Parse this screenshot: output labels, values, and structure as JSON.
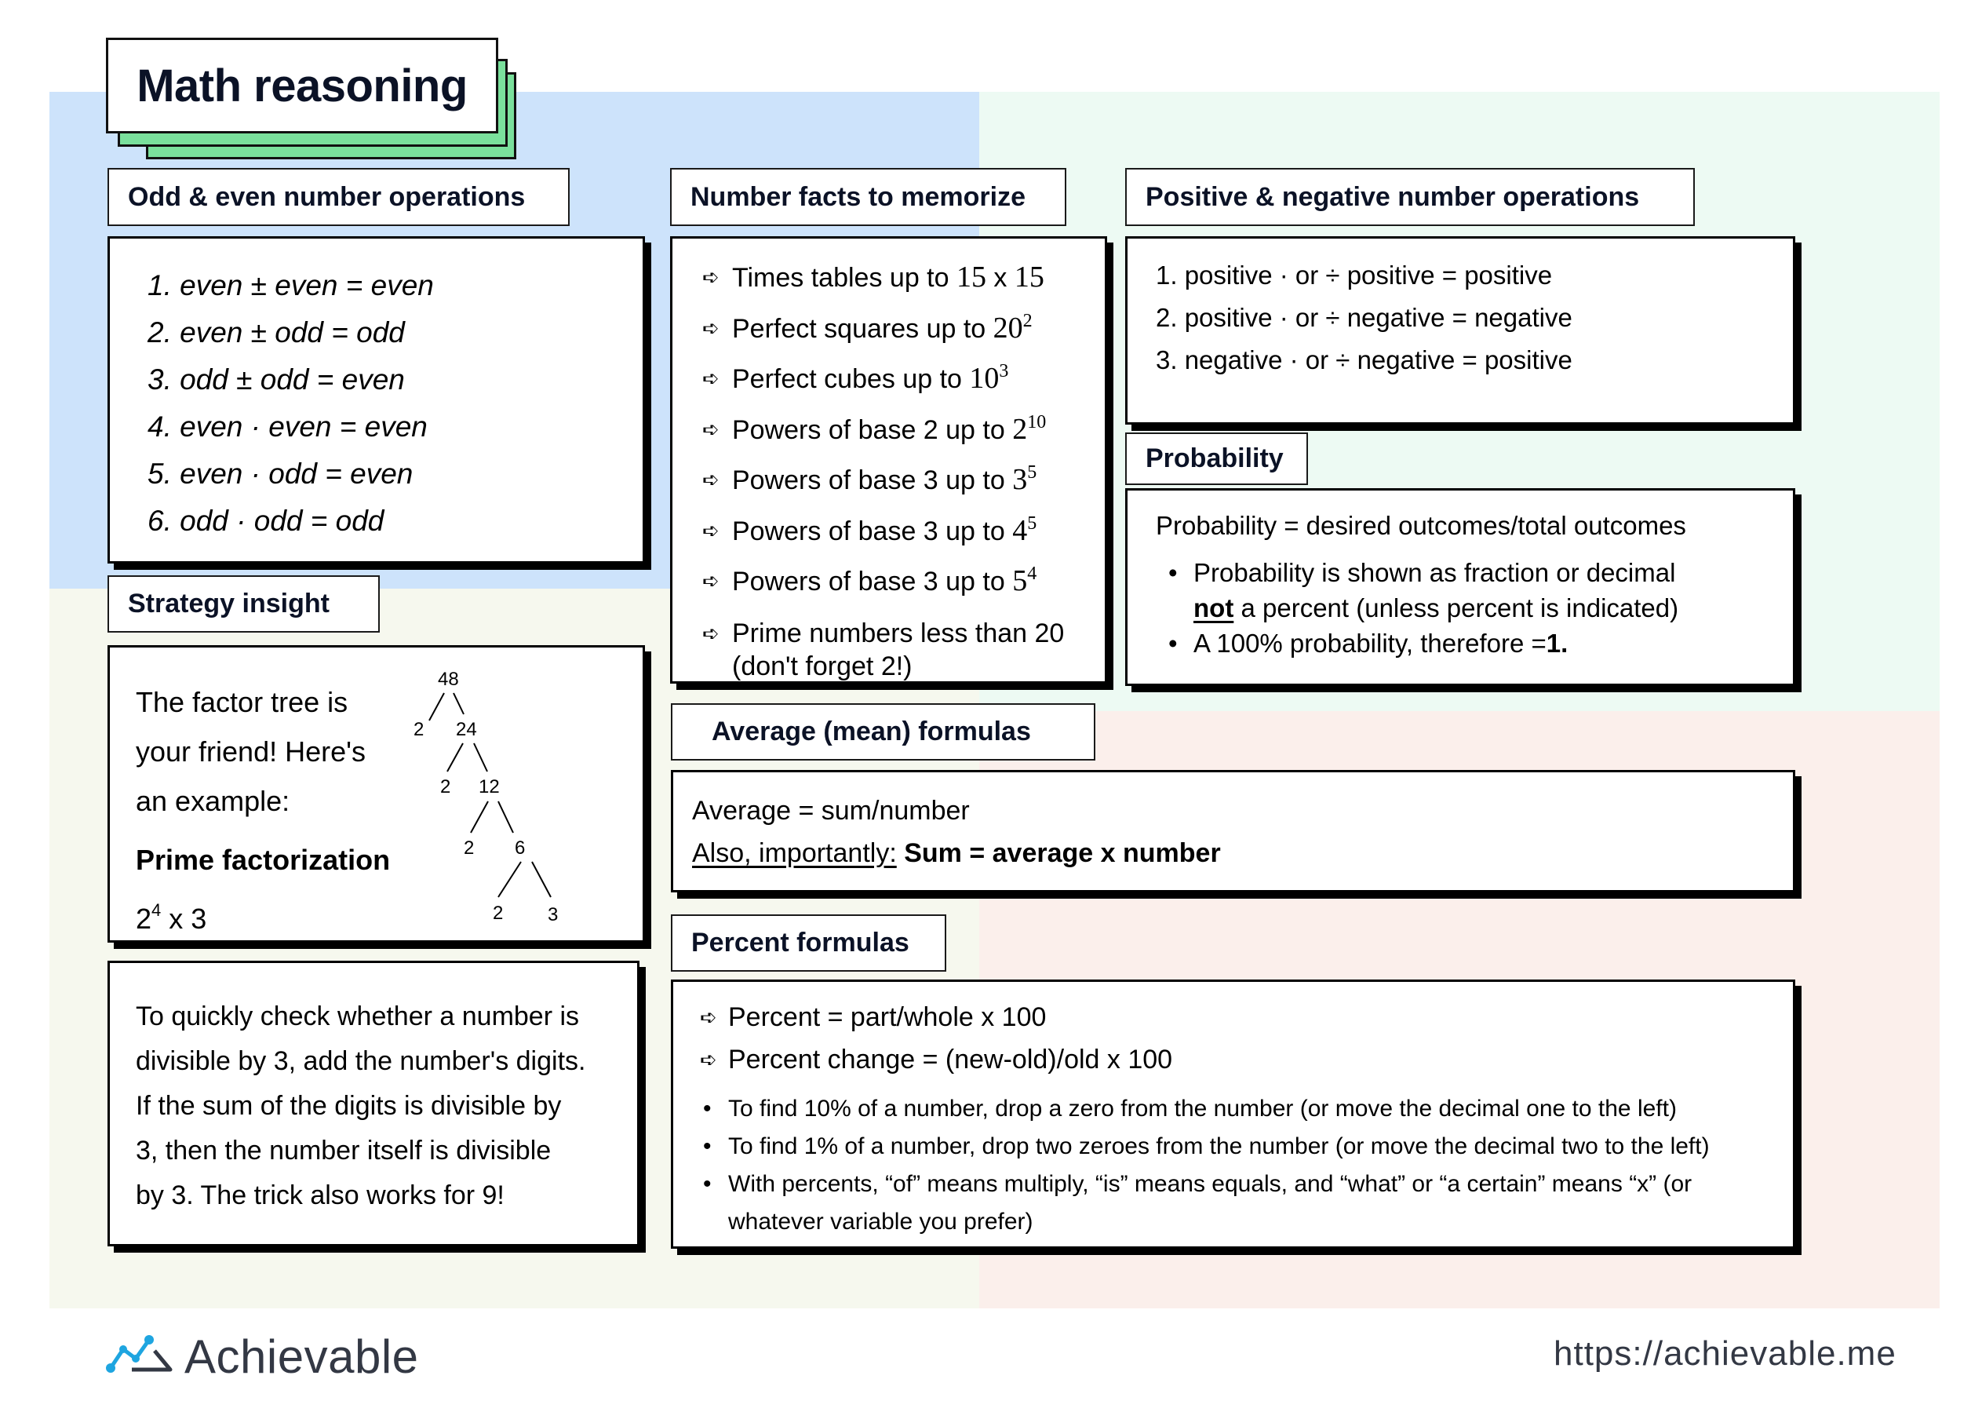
{
  "title": "Math reasoning",
  "colors": {
    "panel_blue": "#cde3fb",
    "panel_cream": "#f6f8ee",
    "panel_green": "#edfaf3",
    "panel_pink": "#fbefeb",
    "title_accent": "#7ae09c",
    "logo_blue": "#1ea5e0",
    "logo_dark": "#333844"
  },
  "odd_even": {
    "heading": "Odd & even number operations",
    "items": [
      "1. even ± even = even",
      "2. even ± odd = odd",
      "3. odd ± odd = even",
      "4. even · even = even",
      "5. even · odd = even",
      "6. odd · odd = odd"
    ]
  },
  "number_facts": {
    "heading": "Number facts to memorize",
    "bullet_icon": "➪",
    "items": [
      {
        "text": "Times tables up to ",
        "math": "15",
        "mid": " x ",
        "math2": "15",
        "sup": ""
      },
      {
        "text": "Perfect squares up to ",
        "math": "20",
        "sup": "2"
      },
      {
        "text": "Perfect cubes up to ",
        "math": "10",
        "sup": "3"
      },
      {
        "text": "Powers of base 2 up to ",
        "math": "2",
        "sup": "10"
      },
      {
        "text": "Powers of base 3 up to ",
        "math": "3",
        "sup": "5"
      },
      {
        "text": "Powers of base 3 up to ",
        "math": "4",
        "sup": "5"
      },
      {
        "text": "Powers of base 3 up to ",
        "math": "5",
        "sup": "4"
      },
      {
        "text": "Prime numbers less than 20",
        "line2": "(don't forget 2!)"
      }
    ]
  },
  "pos_neg": {
    "heading": "Positive & negative number operations",
    "items": [
      "1. positive · or ÷ positive = positive",
      "2. positive · or ÷ negative = negative",
      "3. negative · or ÷ negative = positive"
    ]
  },
  "probability": {
    "heading": "Probability",
    "formula": "Probability = desired outcomes/total outcomes",
    "bullet1_line1": "Probability is shown as fraction or decimal",
    "bullet1_not": "not",
    "bullet1_line2": " a percent (unless percent is indicated)",
    "bullet2_text": "A 100% probability, therefore =",
    "bullet2_bold": "1."
  },
  "strategy": {
    "heading": "Strategy insight",
    "intro": [
      "The factor tree is",
      "your friend! Here's",
      "an example:"
    ],
    "pf_label": "Prime factorization",
    "result_base": "2",
    "result_exp": "4",
    "result_rest": " x 3",
    "tree_nodes": [
      "48",
      "2",
      "24",
      "2",
      "12",
      "2",
      "6",
      "2",
      "3"
    ],
    "divisibility": [
      "To quickly check whether a number is",
      "divisible by 3, add the number's digits.",
      "If the sum of the digits is divisible by",
      "3, then the number itself is divisible",
      "by 3. The trick also works for 9!"
    ]
  },
  "average": {
    "heading": "Average (mean) formulas",
    "line1": "Average = sum/number",
    "line2_underlined": "Also, importantly:",
    "line2_bold": "Sum = average x number"
  },
  "percent": {
    "heading": "Percent formulas",
    "bullet_icon": "➪",
    "formulas": [
      "Percent = part/whole x 100",
      "Percent change = (new-old)/old x 100"
    ],
    "tips": [
      "To find 10% of a number, drop a zero from the number (or move the decimal one to the left)",
      "To find 1% of a number, drop two zeroes from the number (or move the decimal two to the left)",
      "With percents, “of” means multiply, “is” means equals, and “what” or “a certain” means “x” (or whatever variable you prefer)"
    ]
  },
  "footer": {
    "logo_text": "Achievable",
    "logo_icon": "chart-line-mountain-icon",
    "url": "https://achievable.me"
  }
}
